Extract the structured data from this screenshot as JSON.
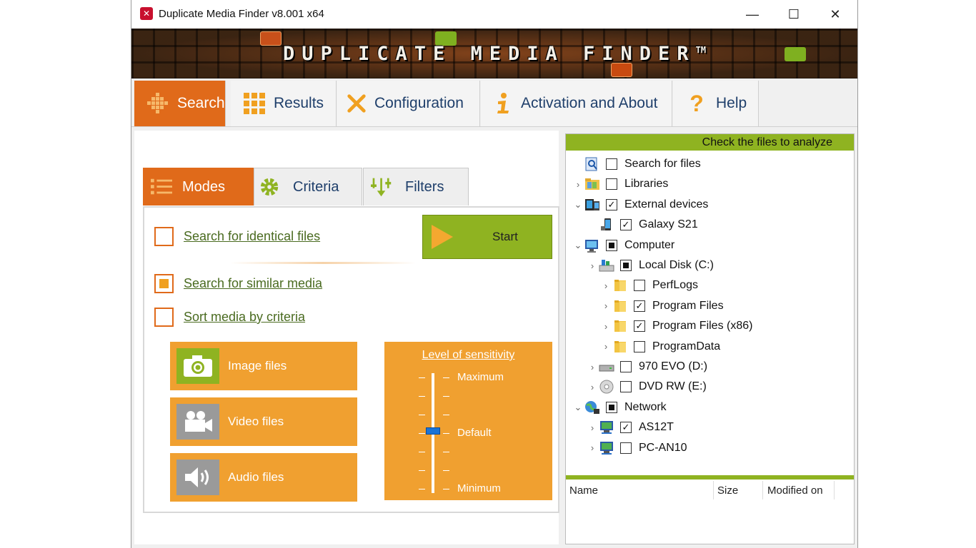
{
  "window": {
    "title": "Duplicate Media Finder    v8.001  x64",
    "minimize_icon": "minimize-icon",
    "maximize_icon": "maximize-icon",
    "close_icon": "close-icon"
  },
  "banner": {
    "title": "DUPLICATE MEDIA FINDER",
    "tm": "TM"
  },
  "main_tabs": [
    {
      "label": "Search",
      "icon": "search-grid-icon",
      "active": true
    },
    {
      "label": "Results",
      "icon": "results-grid-icon",
      "active": false
    },
    {
      "label": "Configuration",
      "icon": "wrench-screwdriver-icon",
      "active": false
    },
    {
      "label": "Activation and About",
      "icon": "info-icon",
      "active": false
    },
    {
      "label": "Help",
      "icon": "question-icon",
      "active": false
    }
  ],
  "sub_tabs": [
    {
      "label": "Modes",
      "icon": "list-icon",
      "active": true
    },
    {
      "label": "Criteria",
      "icon": "gear-icon",
      "active": false
    },
    {
      "label": "Filters",
      "icon": "filter-icon",
      "active": false
    }
  ],
  "modes": {
    "identical": {
      "label": "Search for identical files",
      "checked": false
    },
    "similar": {
      "label": "Search for similar media",
      "checked": true
    },
    "sort": {
      "label": "Sort media by criteria",
      "checked": false
    },
    "start_label": "Start"
  },
  "media_types": [
    {
      "label": "Image files",
      "icon": "camera-icon",
      "enabled": true
    },
    {
      "label": "Video files",
      "icon": "video-camera-icon",
      "enabled": false
    },
    {
      "label": "Audio files",
      "icon": "speaker-icon",
      "enabled": false
    }
  ],
  "sensitivity": {
    "title": "Level of sensitivity",
    "max_label": "Maximum",
    "default_label": "Default",
    "min_label": "Minimum",
    "level": 0.5
  },
  "tree": {
    "header": "Check the files to analyze",
    "items": [
      {
        "label": "Search for files",
        "icon": "search-files-icon",
        "checked": "none"
      },
      {
        "label": "Libraries",
        "icon": "libraries-icon",
        "checked": "none"
      },
      {
        "label": "External devices",
        "icon": "devices-icon",
        "checked": "checked"
      },
      {
        "label": "Galaxy S21",
        "icon": "phone-icon",
        "checked": "checked"
      },
      {
        "label": "Computer",
        "icon": "computer-icon",
        "checked": "partial"
      },
      {
        "label": "Local Disk (C:)",
        "icon": "disk-icon",
        "checked": "partial"
      },
      {
        "label": "PerfLogs",
        "icon": "folder-icon",
        "checked": "none"
      },
      {
        "label": "Program Files",
        "icon": "folder-icon",
        "checked": "checked"
      },
      {
        "label": "Program Files (x86)",
        "icon": "folder-icon",
        "checked": "checked"
      },
      {
        "label": "ProgramData",
        "icon": "folder-icon",
        "checked": "none"
      },
      {
        "label": "970 EVO (D:)",
        "icon": "drive-icon",
        "checked": "none"
      },
      {
        "label": "DVD RW (E:)",
        "icon": "dvd-icon",
        "checked": "none"
      },
      {
        "label": "Network",
        "icon": "network-icon",
        "checked": "partial"
      },
      {
        "label": "AS12T",
        "icon": "network-computer-icon",
        "checked": "checked"
      },
      {
        "label": "PC-AN10",
        "icon": "network-computer-icon",
        "checked": "none"
      }
    ]
  },
  "file_list": {
    "columns": [
      "Name",
      "Size",
      "Modified on"
    ]
  },
  "colors": {
    "accent_orange": "#e06a1a",
    "panel_orange": "#f0a030",
    "accent_green": "#8fb321",
    "link_blue": "#1f3f6b"
  }
}
